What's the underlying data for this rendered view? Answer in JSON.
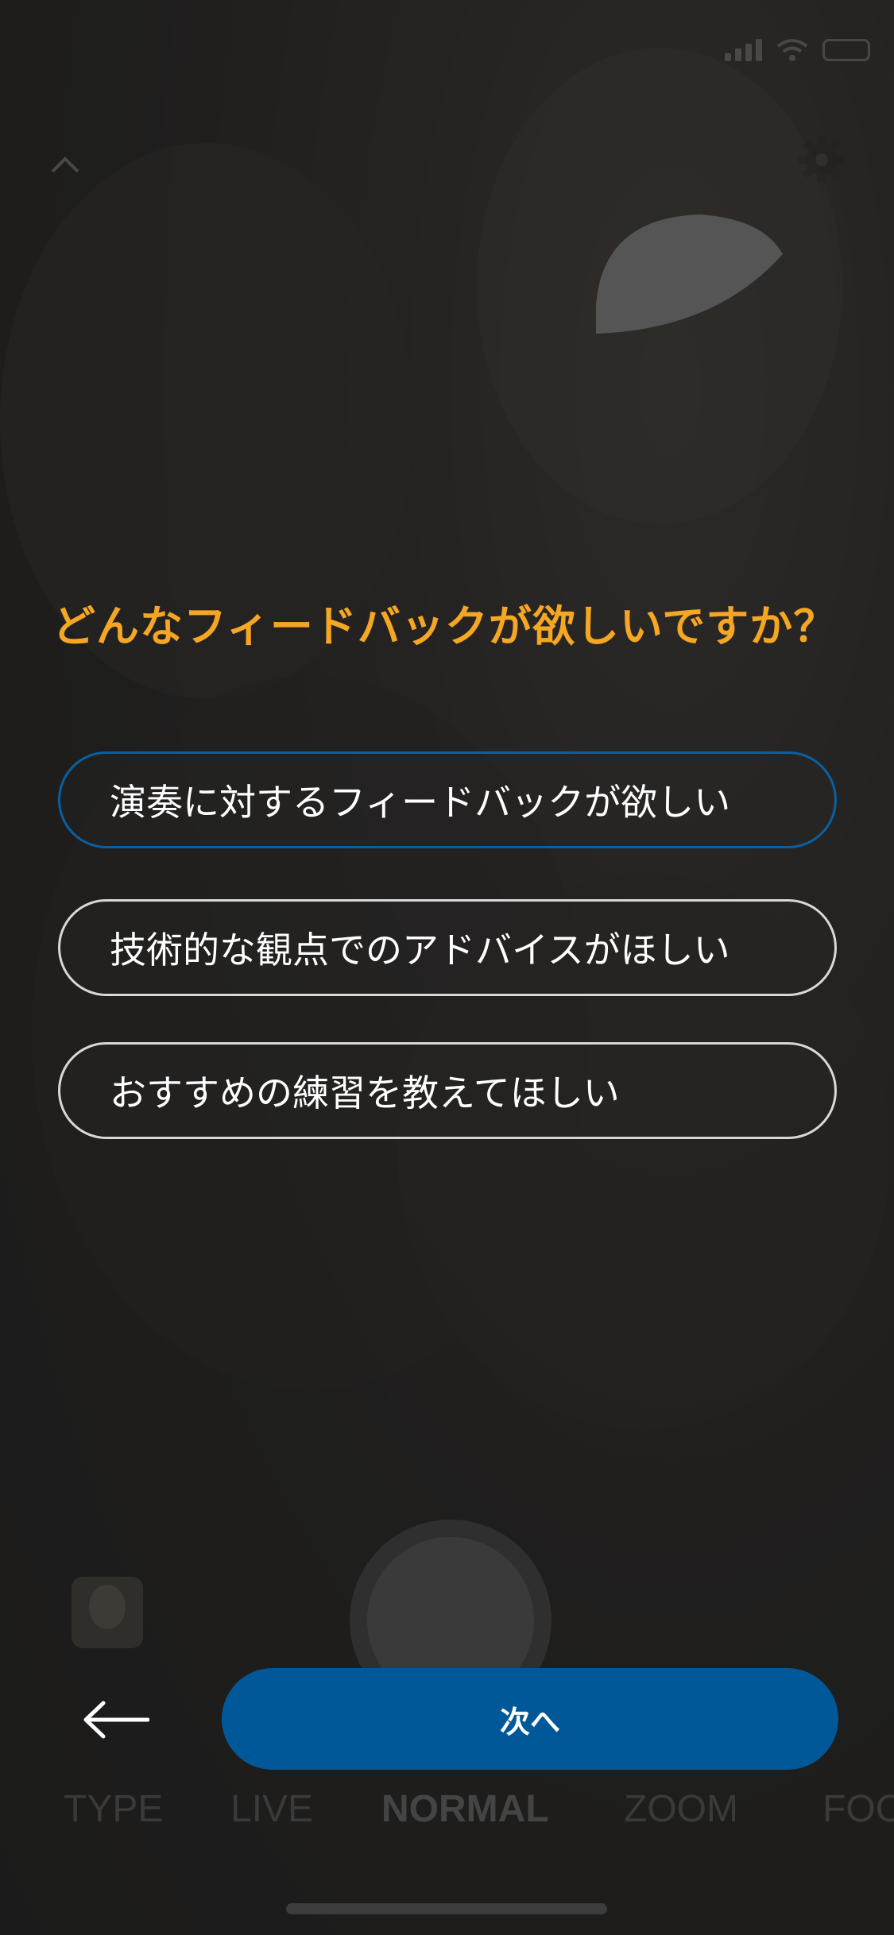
{
  "question": "どんなフィードバックが欲しいですか？",
  "options": [
    {
      "label": "演奏に対するフィードバックが欲しい",
      "selected": true
    },
    {
      "label": "技術的な観点でのアドバイスがほしい",
      "selected": false
    },
    {
      "label": "おすすめの練習を教えてほしい",
      "selected": false
    }
  ],
  "next_button": {
    "label": "次へ"
  },
  "camera_modes": [
    "TYPE",
    "LIVE",
    "NORMAL",
    "ZOOM",
    "FOC"
  ],
  "active_mode": "NORMAL",
  "icons": {
    "back": "left-arrow-icon",
    "collapse": "chevron-up-icon",
    "settings": "gear-icon",
    "pick": "guitar-pick-icon"
  },
  "colors": {
    "question": "#f5a623",
    "selected_border": "#0a5fa0",
    "button": "#005898"
  }
}
